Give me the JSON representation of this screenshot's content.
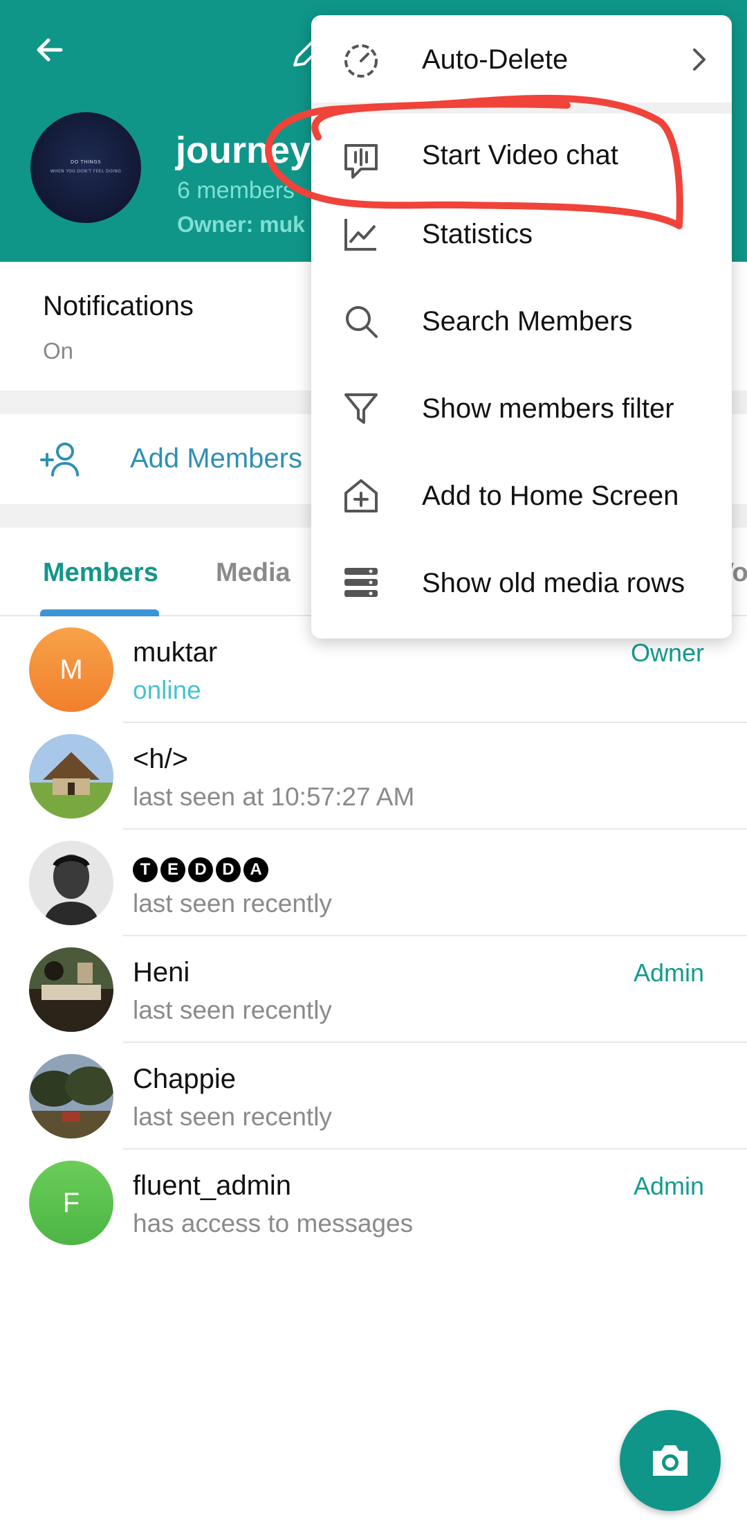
{
  "header": {
    "group_name": "journey t",
    "members_count": "6 members",
    "owner": "Owner: muk",
    "avatar_line1": "DO THINGS",
    "avatar_line2": "WHEN YOU DON'T FEEL DOING"
  },
  "notifications": {
    "title": "Notifications",
    "value": "On"
  },
  "add_members": {
    "label": "Add Members"
  },
  "tabs": [
    {
      "label": "Members",
      "active": true
    },
    {
      "label": "Media",
      "active": false
    },
    {
      "label": "Vo",
      "active": false
    }
  ],
  "members": [
    {
      "name": "muktar",
      "status": "online",
      "role": "Owner",
      "avatar_letter": "M",
      "avatar_color": "#f5903a"
    },
    {
      "name": "<h/>",
      "status": "last seen at 10:57:27 AM",
      "role": ""
    },
    {
      "name": "TEDDA",
      "letters": [
        "T",
        "E",
        "D",
        "D",
        "A"
      ],
      "status": "last seen recently",
      "role": ""
    },
    {
      "name": "Heni",
      "status": "last seen recently",
      "role": "Admin"
    },
    {
      "name": "Chappie",
      "status": "last seen recently",
      "role": ""
    },
    {
      "name": "fluent_admin",
      "status": "has access to messages",
      "role": "Admin",
      "avatar_letter": "F",
      "avatar_color": "#5cc24e"
    }
  ],
  "menu": {
    "items": [
      {
        "label": "Auto-Delete",
        "icon": "timer-icon"
      },
      {
        "label": "Start Video chat",
        "icon": "video-chat-icon"
      },
      {
        "label": "Statistics",
        "icon": "chart-icon"
      },
      {
        "label": "Search Members",
        "icon": "search-icon"
      },
      {
        "label": "Show members filter",
        "icon": "filter-icon"
      },
      {
        "label": "Add to Home Screen",
        "icon": "home-add-icon"
      },
      {
        "label": "Show old media rows",
        "icon": "rows-icon"
      }
    ]
  },
  "colors": {
    "header": "#0f9688",
    "accent": "#12968a",
    "link": "#2f8fb5",
    "annotation": "#f0433a"
  }
}
